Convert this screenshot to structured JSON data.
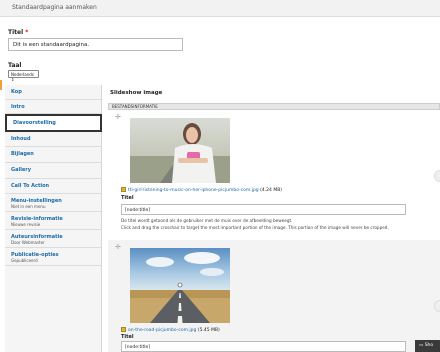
{
  "header": {
    "title": "Standaardpagina aanmaken"
  },
  "form": {
    "title_label": "Titel",
    "title_required": "*",
    "title_value": "Dit is een standaardpagina.",
    "taal_label": "Taal",
    "taal_value": "Nederlands ⇕"
  },
  "tabs": [
    {
      "label": "Kop",
      "sub": ""
    },
    {
      "label": "Intro",
      "sub": ""
    },
    {
      "label": "Diavoorstelling",
      "sub": ""
    },
    {
      "label": "Inhoud",
      "sub": ""
    },
    {
      "label": "Bijlagen",
      "sub": ""
    },
    {
      "label": "Gallery",
      "sub": ""
    },
    {
      "label": "Call To Action",
      "sub": ""
    },
    {
      "label": "Menu-instellingen",
      "sub": "Niet in een menu"
    },
    {
      "label": "Revisie-informatie",
      "sub": "Nieuwe revisie"
    },
    {
      "label": "Auteursinformatie",
      "sub": "Door Webmaster"
    },
    {
      "label": "Publicatie-opties",
      "sub": "Gepubliceerd"
    }
  ],
  "panel": {
    "title": "Slideshow image",
    "info_bar": "BESTANDSINFORMATIE",
    "items": [
      {
        "file_name": "tti-girl-listening-to-music-on-her-iphone-picjumbo-com.jpg",
        "file_size": "(4.24 MB)",
        "title_label": "Titel",
        "title_value": "[node:title]",
        "help1": "De titel wordt getoond als de gebruiker met de muis over de afbeelding beweegt.",
        "help2": "Click and drag the crosshair to target the most important portion of the image. This portion of the image will never be cropped."
      },
      {
        "file_name": "on-the-road-picjumbo-com.jpg",
        "file_size": "(5.45 MB)",
        "title_label": "Titel",
        "title_value": "[node:title]"
      }
    ]
  },
  "toolbar": {
    "label": "Sho"
  },
  "colors": {
    "link": "#1a6aa8",
    "active_border": "#333333",
    "marker": "#f1a33b"
  }
}
